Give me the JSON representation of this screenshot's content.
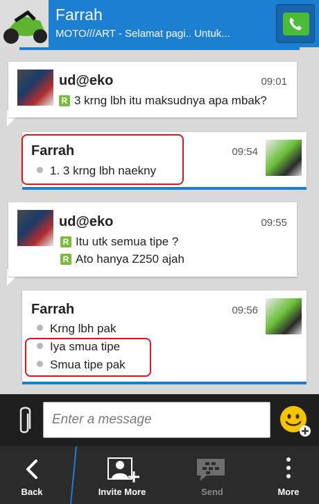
{
  "header": {
    "contact_name": "Farrah",
    "status_message": "MOTO///ART - Selamat pagi.. Untuk..."
  },
  "messages": [
    {
      "sender": "ud@eko",
      "time": "09:01",
      "lines": [
        "3 krng lbh itu maksudnya apa mbak?"
      ]
    },
    {
      "sender": "Farrah",
      "time": "09:54",
      "lines": [
        "1. 3 krng lbh naekny"
      ]
    },
    {
      "sender": "ud@eko",
      "time": "09:55",
      "lines": [
        "Itu utk semua tipe ?",
        "Ato hanya Z250 ajah"
      ]
    },
    {
      "sender": "Farrah",
      "time": "09:56",
      "lines": [
        "Krng lbh pak",
        "Iya smua tipe",
        "Smua tipe pak"
      ]
    }
  ],
  "composer": {
    "placeholder": "Enter a message"
  },
  "action_bar": {
    "back": "Back",
    "invite": "Invite More",
    "send": "Send",
    "more": "More"
  },
  "colors": {
    "accent_blue": "#1d7fcf",
    "read_green": "#7cbb3c",
    "highlight_red": "#d9141a"
  }
}
